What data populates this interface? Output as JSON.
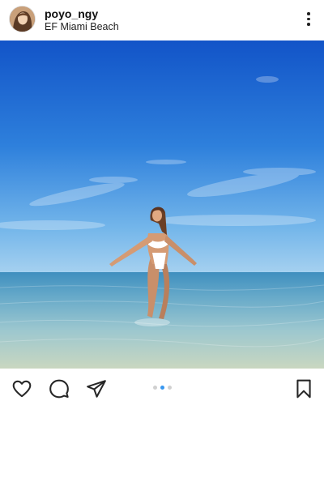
{
  "post": {
    "username": "poyo_ngy",
    "location": "EF Miami Beach"
  },
  "icons": {
    "more": "more-vertical-icon",
    "like": "heart-icon",
    "comment": "comment-icon",
    "share": "send-icon",
    "save": "bookmark-icon"
  },
  "carousel": {
    "total": 3,
    "active_index": 1
  },
  "colors": {
    "accent": "#3897f0",
    "sky_top": "#1256c9",
    "sea": "#5ea6c2"
  }
}
